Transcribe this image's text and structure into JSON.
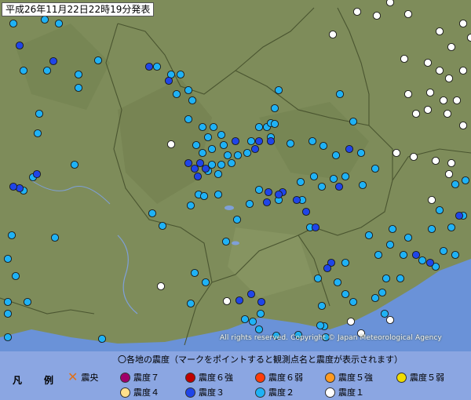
{
  "map": {
    "title": "平成26年11月22日22時19分発表",
    "copyright": "All rights reserved. Copyright © Japan Meteorological Agency"
  },
  "colors": {
    "intensity_1": "#ffffff",
    "intensity_2": "#1fb2f5",
    "intensity_3": "#1f45e8",
    "intensity_4": "#ffe08c",
    "intensity_5_weak": "#f0dc00",
    "intensity_5_strong": "#ff9a20",
    "intensity_6_weak": "#ff3c0a",
    "intensity_6_strong": "#c00000",
    "intensity_7": "#a0006a",
    "epicenter": "#e07018",
    "map_land": "#7e8c5a",
    "sea": "#6a92d8",
    "legend_bg": "#8ba6e2"
  },
  "legend": {
    "label": "凡　例",
    "header": "〇各地の震度（マークをポイントすると観測点名と震度が表示されます）",
    "items": [
      {
        "key": "epicenter",
        "label": "震央",
        "icon": "x-mark-icon"
      },
      {
        "key": "intensity_7",
        "label": "震度７",
        "icon": "circle-icon"
      },
      {
        "key": "intensity_6_strong",
        "label": "震度６強",
        "icon": "circle-icon"
      },
      {
        "key": "intensity_6_weak",
        "label": "震度６弱",
        "icon": "circle-icon"
      },
      {
        "key": "intensity_5_strong",
        "label": "震度５強",
        "icon": "circle-icon"
      },
      {
        "key": "intensity_5_weak",
        "label": "震度５弱",
        "icon": "circle-icon"
      },
      {
        "key": "intensity_4",
        "label": "震度４",
        "icon": "circle-icon"
      },
      {
        "key": "intensity_3",
        "label": "震度３",
        "icon": "circle-icon"
      },
      {
        "key": "intensity_2",
        "label": "震度２",
        "icon": "circle-icon"
      },
      {
        "key": "intensity_1",
        "label": "震度１",
        "icon": "circle-icon"
      }
    ]
  }
}
